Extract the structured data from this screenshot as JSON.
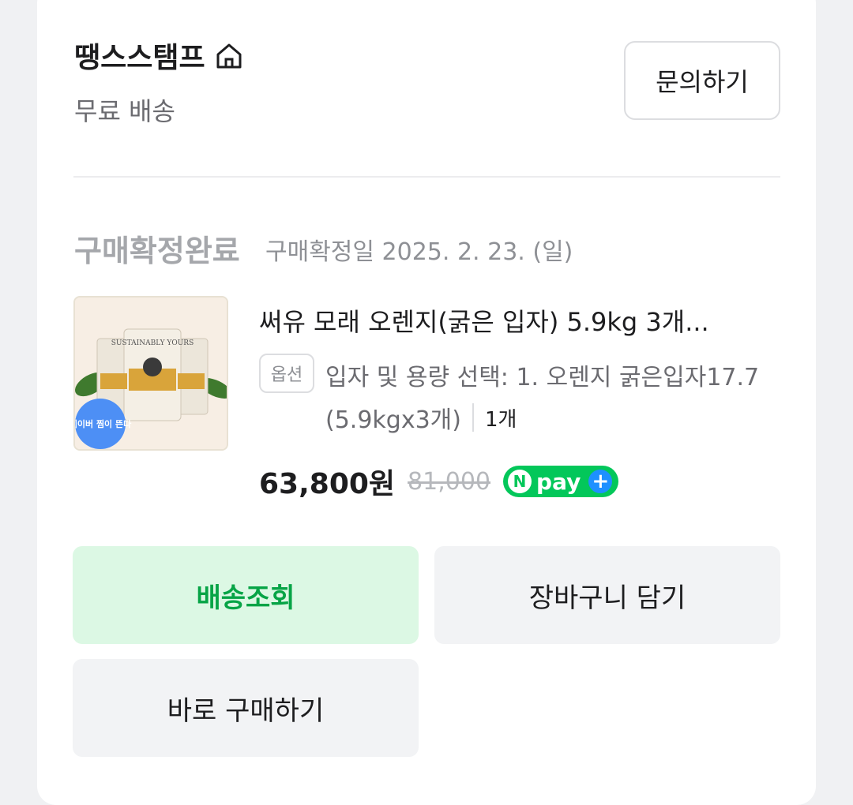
{
  "store": {
    "name": "땡스스탬프",
    "shipping": "무료 배송",
    "inquiry_label": "문의하기"
  },
  "order": {
    "status": "구매확정완료",
    "confirm_date": "구매확정일 2025. 2. 23. (일)"
  },
  "product": {
    "title": "써유 모래 오렌지(굵은 입자) 5.9kg 3개...",
    "option_badge": "옵션",
    "option_text": "입자 및 용량 선택: 1. 오렌지 굵은입자17.7",
    "option_text_cont": "(5.9kgx3개)",
    "quantity": "1개",
    "price": "63,800원",
    "original_price": "81,000",
    "thumb_brand": "SUSTAINABLY YOURS",
    "thumb_badge": "네이버 찜이 뜬다",
    "npay_n": "N",
    "npay_label": "pay",
    "npay_plus": "+"
  },
  "actions": {
    "track": "배송조회",
    "cart": "장바구니 담기",
    "buy": "바로 구매하기"
  },
  "colors": {
    "accent_green": "#07a446",
    "track_bg": "#dcf8e4",
    "npay_green": "#03c75a",
    "npay_blue": "#1e90ff"
  }
}
